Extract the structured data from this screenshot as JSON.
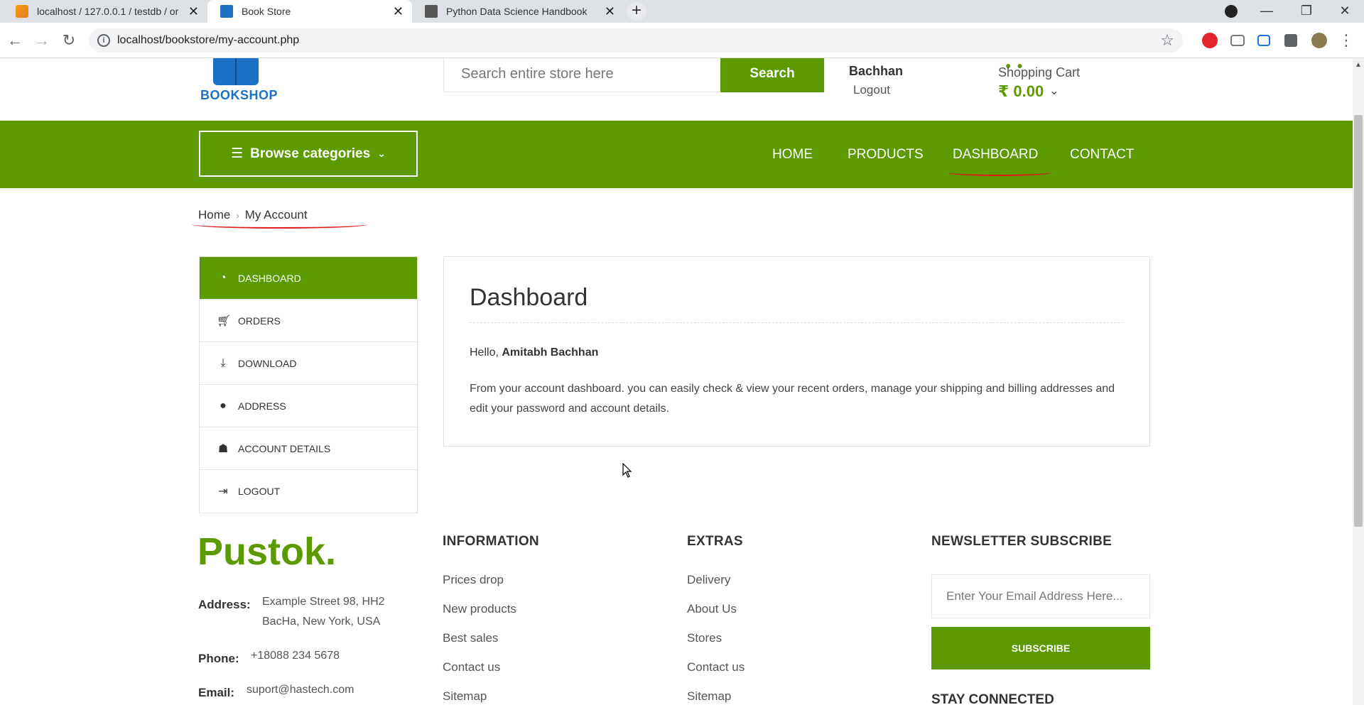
{
  "browser": {
    "tabs": [
      {
        "title": "localhost / 127.0.0.1 / testdb / or",
        "active": false
      },
      {
        "title": "Book Store",
        "active": true
      },
      {
        "title": "Python Data Science Handbook",
        "active": false
      }
    ],
    "new_tab": "+",
    "url": "localhost/bookstore/my-account.php"
  },
  "header": {
    "logo_text": "BOOKSHOP",
    "search_placeholder": "Search entire store here",
    "search_button": "Search",
    "user_name": "Bachhan",
    "logout": "Logout",
    "cart_label": "Shopping Cart",
    "cart_total": "₹ 0.00"
  },
  "nav": {
    "browse": "Browse categories",
    "links": [
      "HOME",
      "PRODUCTS",
      "DASHBOARD",
      "CONTACT"
    ]
  },
  "breadcrumb": {
    "home": "Home",
    "current": "My Account"
  },
  "account_menu": [
    {
      "label": "DASHBOARD",
      "icon": "dashboard-icon",
      "active": true
    },
    {
      "label": "ORDERS",
      "icon": "cart-icon",
      "active": false
    },
    {
      "label": "DOWNLOAD",
      "icon": "download-icon",
      "active": false
    },
    {
      "label": "ADDRESS",
      "icon": "map-marker-icon",
      "active": false
    },
    {
      "label": "ACCOUNT DETAILS",
      "icon": "user-icon",
      "active": false
    },
    {
      "label": "LOGOUT",
      "icon": "sign-out-icon",
      "active": false
    }
  ],
  "dashboard": {
    "title": "Dashboard",
    "hello_prefix": "Hello, ",
    "hello_name": "Amitabh Bachhan",
    "description": "From your account dashboard. you can easily check & view your recent orders, manage your shipping and billing addresses and edit your password and account details."
  },
  "footer": {
    "brand": "Pustok.",
    "address_label": "Address:",
    "address_line1": "Example Street 98, HH2",
    "address_line2": "BacHa, New York, USA",
    "phone_label": "Phone:",
    "phone": "+18088 234 5678",
    "email_label": "Email:",
    "email": "suport@hastech.com",
    "information": {
      "heading": "INFORMATION",
      "items": [
        "Prices drop",
        "New products",
        "Best sales",
        "Contact us",
        "Sitemap"
      ]
    },
    "extras": {
      "heading": "EXTRAS",
      "items": [
        "Delivery",
        "About Us",
        "Stores",
        "Contact us",
        "Sitemap"
      ]
    },
    "newsletter": {
      "heading": "NEWSLETTER SUBSCRIBE",
      "placeholder": "Enter Your Email Address Here...",
      "button": "SUBSCRIBE",
      "stay_connected": "STAY CONNECTED"
    }
  },
  "colors": {
    "brand_green": "#5d9a02",
    "annotation_red": "#e01b1b",
    "logo_blue": "#1b6fc4"
  }
}
